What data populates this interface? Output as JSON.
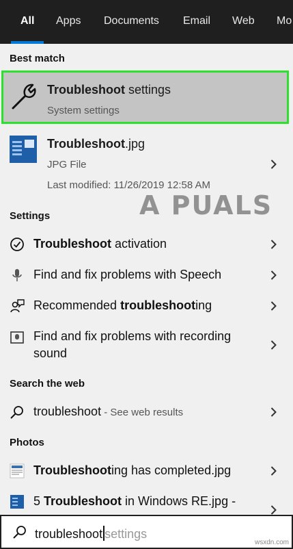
{
  "tabs": [
    {
      "label": "All",
      "active": true
    },
    {
      "label": "Apps"
    },
    {
      "label": "Documents"
    },
    {
      "label": "Email"
    },
    {
      "label": "Web"
    },
    {
      "label": "Mo"
    }
  ],
  "best_match": {
    "heading": "Best match",
    "title_bold": "Troubleshoot",
    "title_rest": " settings",
    "subtitle": "System settings",
    "icon": "wrench-icon",
    "highlight_color": "#2ee02e"
  },
  "file_result": {
    "title_bold": "Troubleshoot",
    "title_rest": ".jpg",
    "type": "JPG File",
    "modified": "Last modified: 11/26/2019 12:58 AM"
  },
  "watermark": "A PUALS",
  "settings": {
    "heading": "Settings",
    "items": [
      {
        "pre": "",
        "bold": "Troubleshoot",
        "post": " activation",
        "icon": "checkmark-circle-icon"
      },
      {
        "pre": "Find and fix problems with Speech",
        "bold": "",
        "post": "",
        "icon": "microphone-icon"
      },
      {
        "pre": "Recommended ",
        "bold": "troubleshoot",
        "post": "ing",
        "icon": "person-chat-icon"
      },
      {
        "pre": "Find and fix problems with recording",
        "line2": "sound",
        "icon": "recording-icon"
      }
    ]
  },
  "web": {
    "heading": "Search the web",
    "query": "troubleshoot",
    "hint": " - See web results",
    "icon": "search-icon"
  },
  "photos": {
    "heading": "Photos",
    "items": [
      {
        "bold": "Troubleshoot",
        "post": "ing has completed.jpg"
      },
      {
        "pre": "5 ",
        "bold": "Troubleshoot",
        "post": " in Windows RE.jpg -"
      }
    ]
  },
  "searchbox": {
    "typed": "troubleshoot",
    "suggestion": "settings"
  },
  "credit": "wsxdn.com"
}
